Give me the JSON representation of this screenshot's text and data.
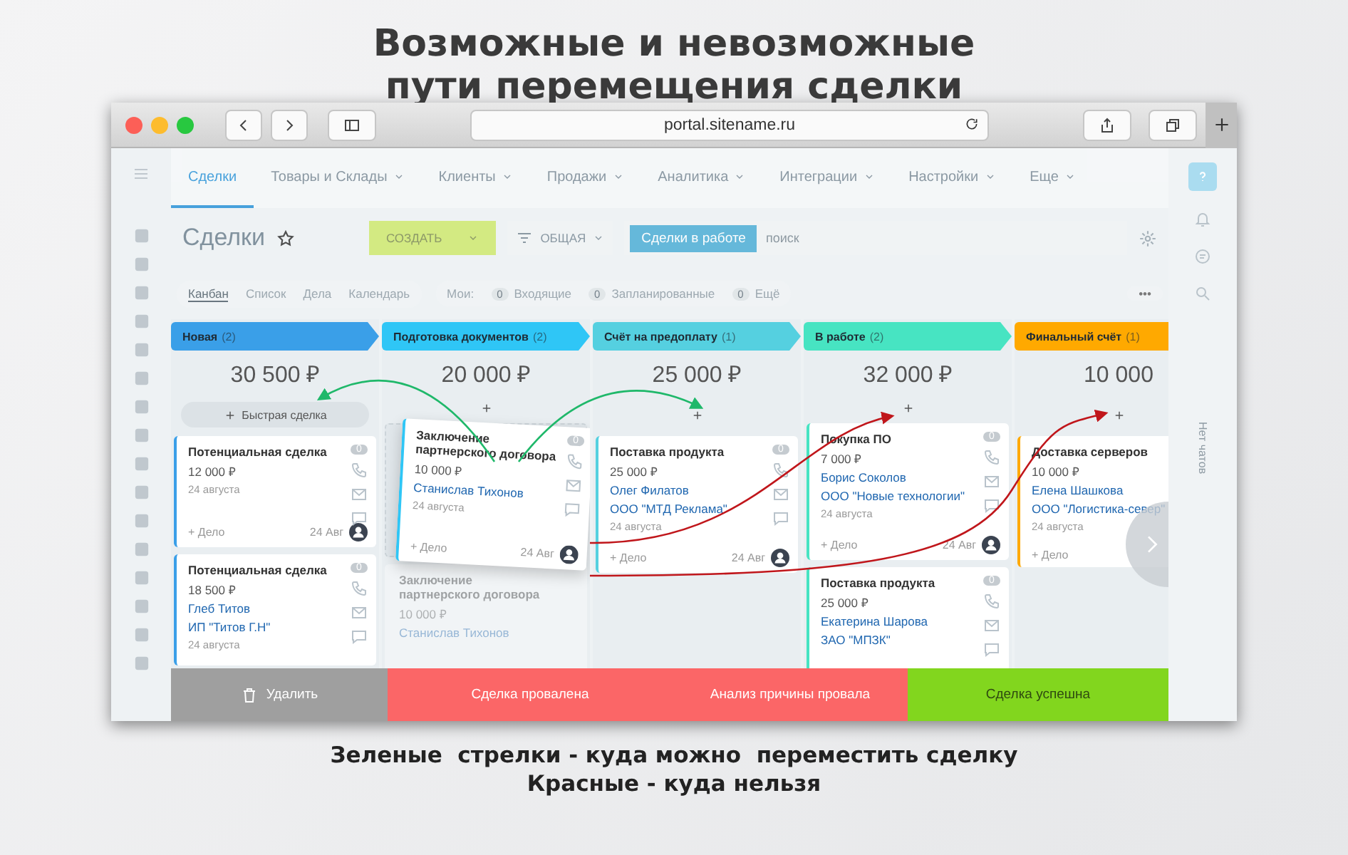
{
  "headline": [
    "Возможные и невозможные",
    "пути перемещения сделки"
  ],
  "browser": {
    "url": "portal.sitename.ru"
  },
  "nav": [
    {
      "label": "Сделки",
      "selected": true,
      "dropdown": false
    },
    {
      "label": "Товары и Склады",
      "selected": false,
      "dropdown": true
    },
    {
      "label": "Клиенты",
      "selected": false,
      "dropdown": true
    },
    {
      "label": "Продажи",
      "selected": false,
      "dropdown": true
    },
    {
      "label": "Аналитика",
      "selected": false,
      "dropdown": true
    },
    {
      "label": "Интеграции",
      "selected": false,
      "dropdown": true
    },
    {
      "label": "Настройки",
      "selected": false,
      "dropdown": true
    },
    {
      "label": "Еще",
      "selected": false,
      "dropdown": true
    }
  ],
  "toolbar": {
    "title": "Сделки",
    "create_button": "СОЗДАТЬ",
    "preset": "ОБЩАЯ",
    "filter_tag": "Сделки в работе",
    "search_placeholder": "поиск"
  },
  "views": [
    {
      "label": "Канбан",
      "selected": true
    },
    {
      "label": "Список",
      "selected": false
    },
    {
      "label": "Дела",
      "selected": false
    },
    {
      "label": "Календарь",
      "selected": false
    }
  ],
  "counters_label": "Мои:",
  "more_button": "•••",
  "counters": [
    {
      "count": "0",
      "label": "Входящие"
    },
    {
      "count": "0",
      "label": "Запланированные"
    },
    {
      "count": "0",
      "label": "Ещё"
    }
  ],
  "columns": [
    {
      "title": "Новая",
      "count": "(2)",
      "color": "#3a9fe8",
      "total": "30 500 ₽",
      "add_label": "Быстрая сделка",
      "cards": [
        {
          "kind": "card",
          "title": "Потенциальная сделка",
          "amount": "12 000 ₽",
          "date": "24 августа",
          "activity": "+ Дело",
          "due": "24 Авг",
          "badge": "0"
        },
        {
          "kind": "card",
          "title": "Потенциальная сделка",
          "amount": "18 500 ₽",
          "contact": "Глеб Титов",
          "company": "ИП \"Титов Г.Н\"",
          "date": "24 августа",
          "badge": "0"
        }
      ]
    },
    {
      "title": "Подготовка документов",
      "count": "(2)",
      "color": "#2fc6f6",
      "total": "20 000 ₽",
      "cards": [
        {
          "kind": "dragged",
          "title": "Заключение партнерского договора",
          "amount": "10 000 ₽",
          "contact": "Станислав Тихонов",
          "date": "24 августа",
          "activity": "+ Дело",
          "due": "24 Авг",
          "badge": "0"
        },
        {
          "kind": "ghost",
          "title": "Заключение партнерского договора",
          "amount": "10 000 ₽",
          "contact": "Станислав Тихонов"
        }
      ]
    },
    {
      "title": "Счёт на предоплату",
      "count": "(1)",
      "color": "#55d0e0",
      "total": "25 000 ₽",
      "cards": [
        {
          "kind": "card",
          "title": "Поставка продукта",
          "amount": "25 000 ₽",
          "contact": "Олег Филатов",
          "company": "ООО \"МТД Реклама\"",
          "date": "24 августа",
          "activity": "+ Дело",
          "due": "24 Авг",
          "badge": "0"
        }
      ]
    },
    {
      "title": "В работе",
      "count": "(2)",
      "color": "#47e4c2",
      "total": "32 000 ₽",
      "cards": [
        {
          "kind": "card",
          "title": "Покупка ПО",
          "amount": "7 000 ₽",
          "contact": "Борис Соколов",
          "company": "ООО \"Новые технологии\"",
          "date": "24 августа",
          "activity": "+ Дело",
          "due": "24 Авг",
          "badge": "0"
        },
        {
          "kind": "card",
          "title": "Поставка продукта",
          "amount": "25 000 ₽",
          "contact": "Екатерина Шарова",
          "company": "ЗАО \"МПЗК\"",
          "badge": "0"
        }
      ]
    },
    {
      "title": "Финальный счёт",
      "count": "(1)",
      "color": "#ffa900",
      "total": "10 000",
      "cards": [
        {
          "kind": "card",
          "title": "Доставка серверов",
          "amount": "10 000 ₽",
          "contact": "Елена Шашкова",
          "company": "ООО \"Логистика-север\"",
          "date": "24 августа",
          "activity": "+ Дело"
        }
      ]
    }
  ],
  "actions": [
    {
      "kind": "delete",
      "label": "Удалить"
    },
    {
      "kind": "fail",
      "label": "Сделка провалена"
    },
    {
      "kind": "fail",
      "label": "Анализ причины провала"
    },
    {
      "kind": "success",
      "label": "Сделка успешна"
    }
  ],
  "arrows": [
    {
      "allowed": true
    },
    {
      "allowed": true
    },
    {
      "allowed": false
    },
    {
      "allowed": false
    }
  ],
  "chats_label": "Нет чатов",
  "caption": [
    "Зеленые  стрелки - куда можно  переместить сделку",
    "Красные - куда нельзя"
  ]
}
